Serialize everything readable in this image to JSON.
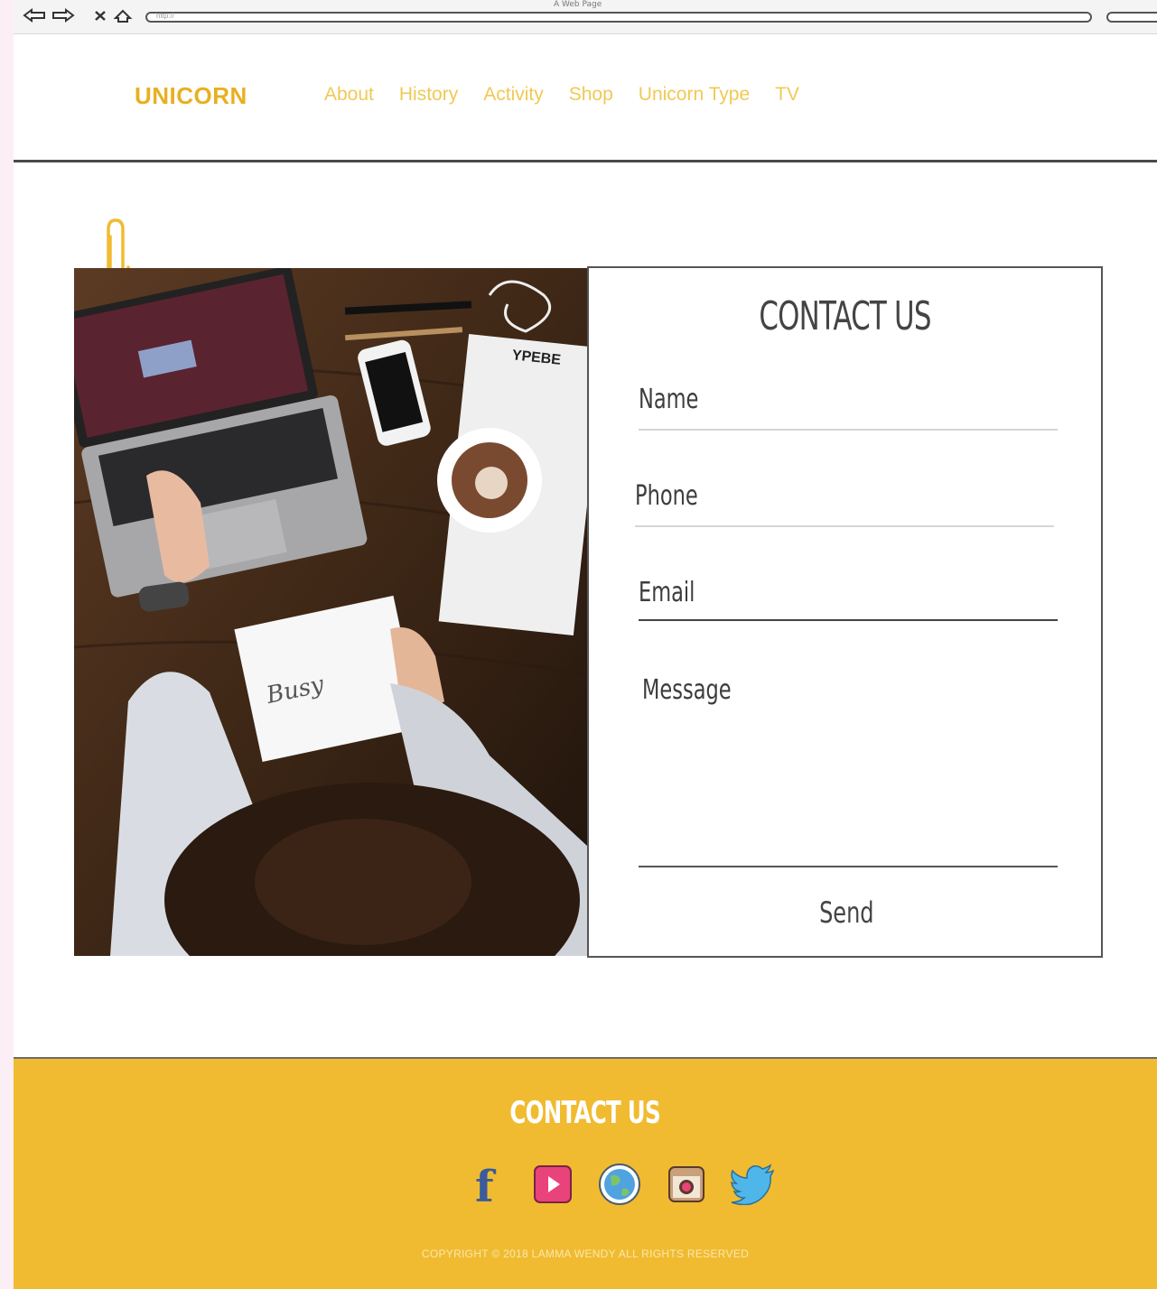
{
  "browser": {
    "window_title": "A Web Page",
    "url_placeholder": "http://"
  },
  "header": {
    "brand": "UNICORN",
    "nav": [
      {
        "label": "About"
      },
      {
        "label": "History"
      },
      {
        "label": "Activity"
      },
      {
        "label": "Shop"
      },
      {
        "label": "Unicorn Type"
      },
      {
        "label": "TV"
      }
    ]
  },
  "contact_form": {
    "title": "CONTACT US",
    "name_label": "Name",
    "phone_label": "Phone",
    "email_label": "Email",
    "message_label": "Message",
    "send_label": "Send"
  },
  "footer": {
    "title": "CONTACT US",
    "social_icons": [
      "facebook-icon",
      "youtube-icon",
      "globe-icon",
      "instagram-icon",
      "twitter-icon"
    ],
    "copyright": "COPYRIGHT © 2018 LAMMA WENDY ALL RIGHTS RESERVED"
  },
  "colors": {
    "brand": "#e8b021",
    "nav": "#f0c955",
    "footer_bg": "#f0bb30"
  }
}
